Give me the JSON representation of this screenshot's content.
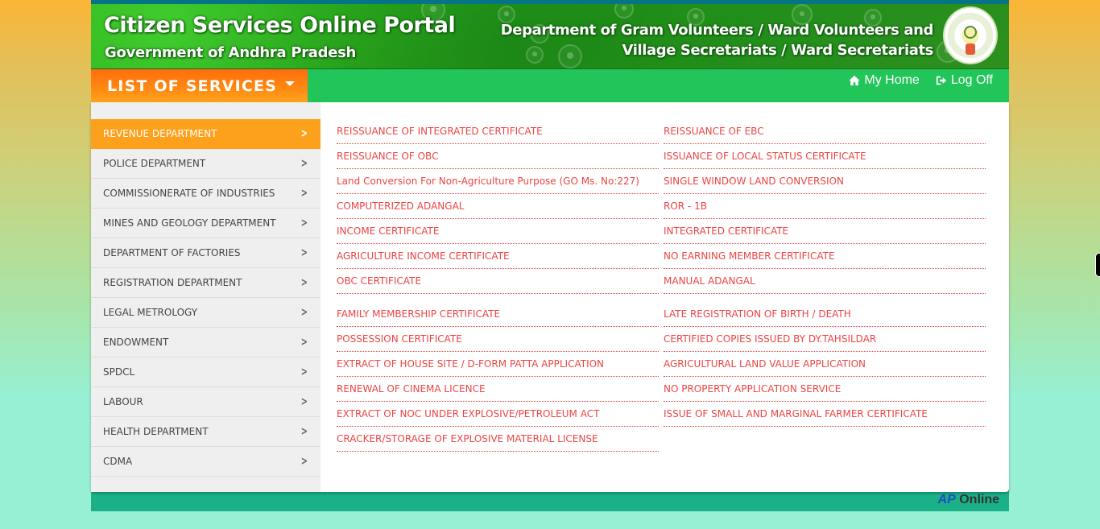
{
  "header": {
    "title": "Citizen Services Online Portal",
    "subtitle": "Government of Andhra Pradesh",
    "department_line1": "Department of Gram Volunteers / Ward Volunteers and",
    "department_line2": "Village Secretariats / Ward Secretariats",
    "emblem_icon": "ap-state-emblem"
  },
  "nav": {
    "services_label": "LIST OF SERVICES",
    "my_home_label": "My Home",
    "log_off_label": "Log Off",
    "home_icon": "home-icon",
    "logoff_icon": "sign-out-icon"
  },
  "sidebar": {
    "active_index": 0,
    "items": [
      {
        "label": "REVENUE DEPARTMENT"
      },
      {
        "label": "POLICE DEPARTMENT"
      },
      {
        "label": "COMMISSIONERATE OF INDUSTRIES"
      },
      {
        "label": "MINES AND GEOLOGY DEPARTMENT"
      },
      {
        "label": "DEPARTMENT OF FACTORIES"
      },
      {
        "label": "REGISTRATION DEPARTMENT"
      },
      {
        "label": "LEGAL METROLOGY"
      },
      {
        "label": "ENDOWMENT"
      },
      {
        "label": "SPDCL"
      },
      {
        "label": "LABOUR"
      },
      {
        "label": "HEALTH DEPARTMENT"
      },
      {
        "label": "CDMA"
      }
    ]
  },
  "services": {
    "left": [
      "REISSUANCE OF INTEGRATED CERTIFICATE",
      "REISSUANCE OF OBC",
      "Land Conversion For Non-Agriculture Purpose (GO Ms. No:227)",
      "COMPUTERIZED ADANGAL",
      "INCOME CERTIFICATE",
      "AGRICULTURE INCOME CERTIFICATE",
      "OBC CERTIFICATE",
      "FAMILY MEMBERSHIP CERTIFICATE",
      "POSSESSION CERTIFICATE",
      "EXTRACT OF HOUSE SITE / D-FORM PATTA APPLICATION",
      "RENEWAL OF CINEMA LICENCE",
      "EXTRACT OF NOC UNDER EXPLOSIVE/PETROLEUM ACT",
      "CRACKER/STORAGE OF EXPLOSIVE MATERIAL LICENSE"
    ],
    "right": [
      "REISSUANCE OF EBC",
      "ISSUANCE OF LOCAL STATUS CERTIFICATE",
      "SINGLE WINDOW LAND CONVERSION",
      "ROR - 1B",
      "INTEGRATED CERTIFICATE",
      "NO EARNING MEMBER CERTIFICATE",
      "MANUAL ADANGAL",
      "LATE REGISTRATION OF BIRTH / DEATH",
      "CERTIFIED COPIES ISSUED BY DY.TAHSILDAR",
      "AGRICULTURAL LAND VALUE APPLICATION",
      "NO PROPERTY APPLICATION SERVICE",
      "ISSUE OF SMALL AND MARGINAL FARMER CERTIFICATE"
    ]
  },
  "footer": {
    "brand_prefix": "AP",
    "brand_suffix": "Online"
  },
  "colors": {
    "accent_orange": "#fda11c",
    "nav_green": "#22c55a",
    "service_link": "#ee4444",
    "footer_teal": "#1bb188"
  }
}
